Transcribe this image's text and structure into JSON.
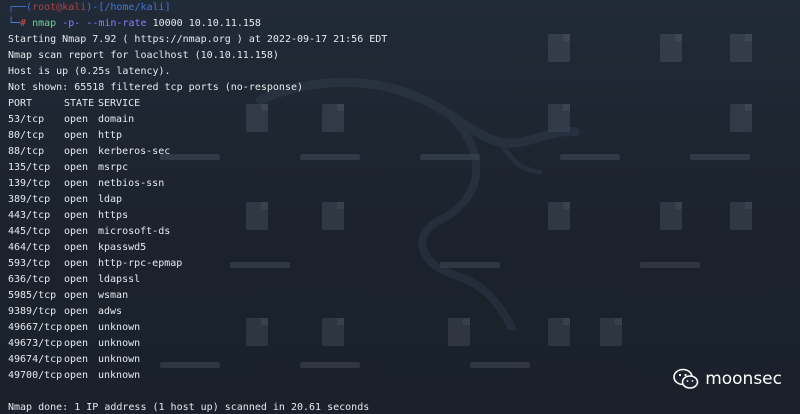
{
  "prompt": {
    "user_host": "root@kali",
    "path": "/home/kali",
    "symbol": "#"
  },
  "command": {
    "name": "nmap",
    "flags": "-p- --min-rate",
    "rate": "10000",
    "target": "10.10.11.158"
  },
  "header_lines": [
    "Starting Nmap 7.92 ( https://nmap.org ) at 2022-09-17 21:56 EDT",
    "Nmap scan report for loaclhost (10.10.11.158)",
    "Host is up (0.25s latency).",
    "Not shown: 65518 filtered tcp ports (no-response)"
  ],
  "table": {
    "headers": [
      "PORT",
      "STATE",
      "SERVICE"
    ],
    "rows": [
      [
        "53/tcp",
        "open",
        "domain"
      ],
      [
        "80/tcp",
        "open",
        "http"
      ],
      [
        "88/tcp",
        "open",
        "kerberos-sec"
      ],
      [
        "135/tcp",
        "open",
        "msrpc"
      ],
      [
        "139/tcp",
        "open",
        "netbios-ssn"
      ],
      [
        "389/tcp",
        "open",
        "ldap"
      ],
      [
        "443/tcp",
        "open",
        "https"
      ],
      [
        "445/tcp",
        "open",
        "microsoft-ds"
      ],
      [
        "464/tcp",
        "open",
        "kpasswd5"
      ],
      [
        "593/tcp",
        "open",
        "http-rpc-epmap"
      ],
      [
        "636/tcp",
        "open",
        "ldapssl"
      ],
      [
        "5985/tcp",
        "open",
        "wsman"
      ],
      [
        "9389/tcp",
        "open",
        "adws"
      ],
      [
        "49667/tcp",
        "open",
        "unknown"
      ],
      [
        "49673/tcp",
        "open",
        "unknown"
      ],
      [
        "49674/tcp",
        "open",
        "unknown"
      ],
      [
        "49700/tcp",
        "open",
        "unknown"
      ]
    ]
  },
  "footer_line": "Nmap done: 1 IP address (1 host up) scanned in 20.61 seconds",
  "watermark": {
    "text": "moonsec",
    "icon": "wechat-icon"
  },
  "colors": {
    "background": "#1d2430",
    "text": "#e7e9ee",
    "prompt_blue": "#4d88ff",
    "user_red": "#d24b47",
    "command_green": "#6fcf97",
    "flag_purple": "#8a7dff"
  }
}
